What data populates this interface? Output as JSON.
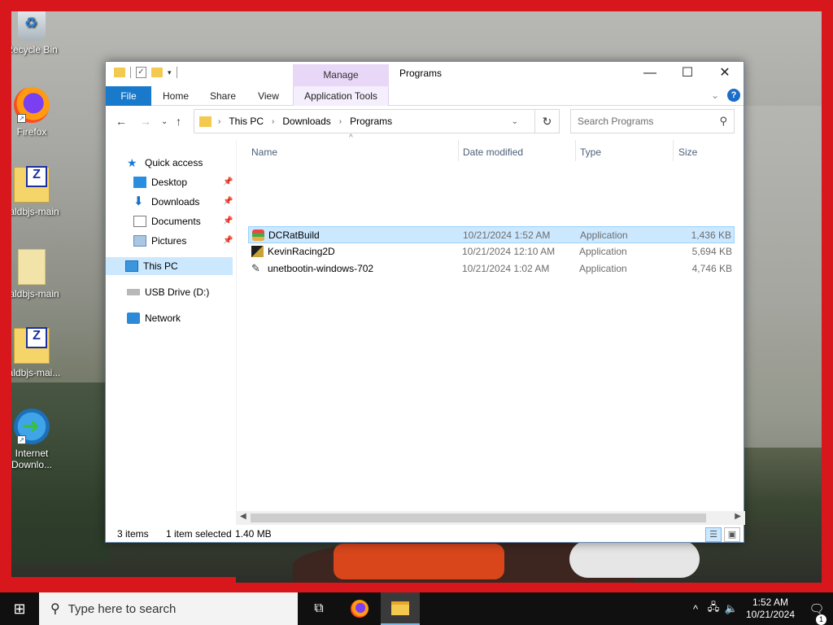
{
  "desktop": {
    "icons": [
      {
        "label": "Recycle Bin"
      },
      {
        "label": "Firefox"
      },
      {
        "label": "caldbjs-main"
      },
      {
        "label": "caldbjs-main"
      },
      {
        "label": "caldbjs-mai..."
      },
      {
        "label": "Internet Downlo..."
      }
    ]
  },
  "window": {
    "title": "Programs",
    "contextual_tab_group": "Manage",
    "ribbon_tabs": [
      "File",
      "Home",
      "Share",
      "View",
      "Application Tools"
    ],
    "breadcrumb": [
      "This PC",
      "Downloads",
      "Programs"
    ],
    "search_placeholder": "Search Programs",
    "nav": {
      "quick_access": "Quick access",
      "items": [
        "Desktop",
        "Downloads",
        "Documents",
        "Pictures"
      ],
      "this_pc": "This PC",
      "usb": "USB Drive (D:)",
      "network": "Network"
    },
    "columns": [
      "Name",
      "Date modified",
      "Type",
      "Size"
    ],
    "files": [
      {
        "name": "DCRatBuild",
        "date": "10/21/2024 1:52 AM",
        "type": "Application",
        "size": "1,436 KB",
        "icon": "dcrat-app-icon",
        "selected": true
      },
      {
        "name": "KevinRacing2D",
        "date": "10/21/2024 12:10 AM",
        "type": "Application",
        "size": "5,694 KB",
        "icon": "game-app-icon",
        "selected": false
      },
      {
        "name": "unetbootin-windows-702",
        "date": "10/21/2024 1:02 AM",
        "type": "Application",
        "size": "4,746 KB",
        "icon": "installer-icon",
        "selected": false
      }
    ],
    "status": {
      "count": "3 items",
      "selected": "1 item selected",
      "size": "1.40 MB"
    }
  },
  "taskbar": {
    "search_placeholder": "Type here to search",
    "time": "1:52 AM",
    "date": "10/21/2024",
    "notifications": "1"
  },
  "colors": {
    "frame_red": "#d7171c",
    "file_tab_blue": "#1979ca",
    "selection": "#cce8ff",
    "manage_purple": "#e9d7f8"
  }
}
